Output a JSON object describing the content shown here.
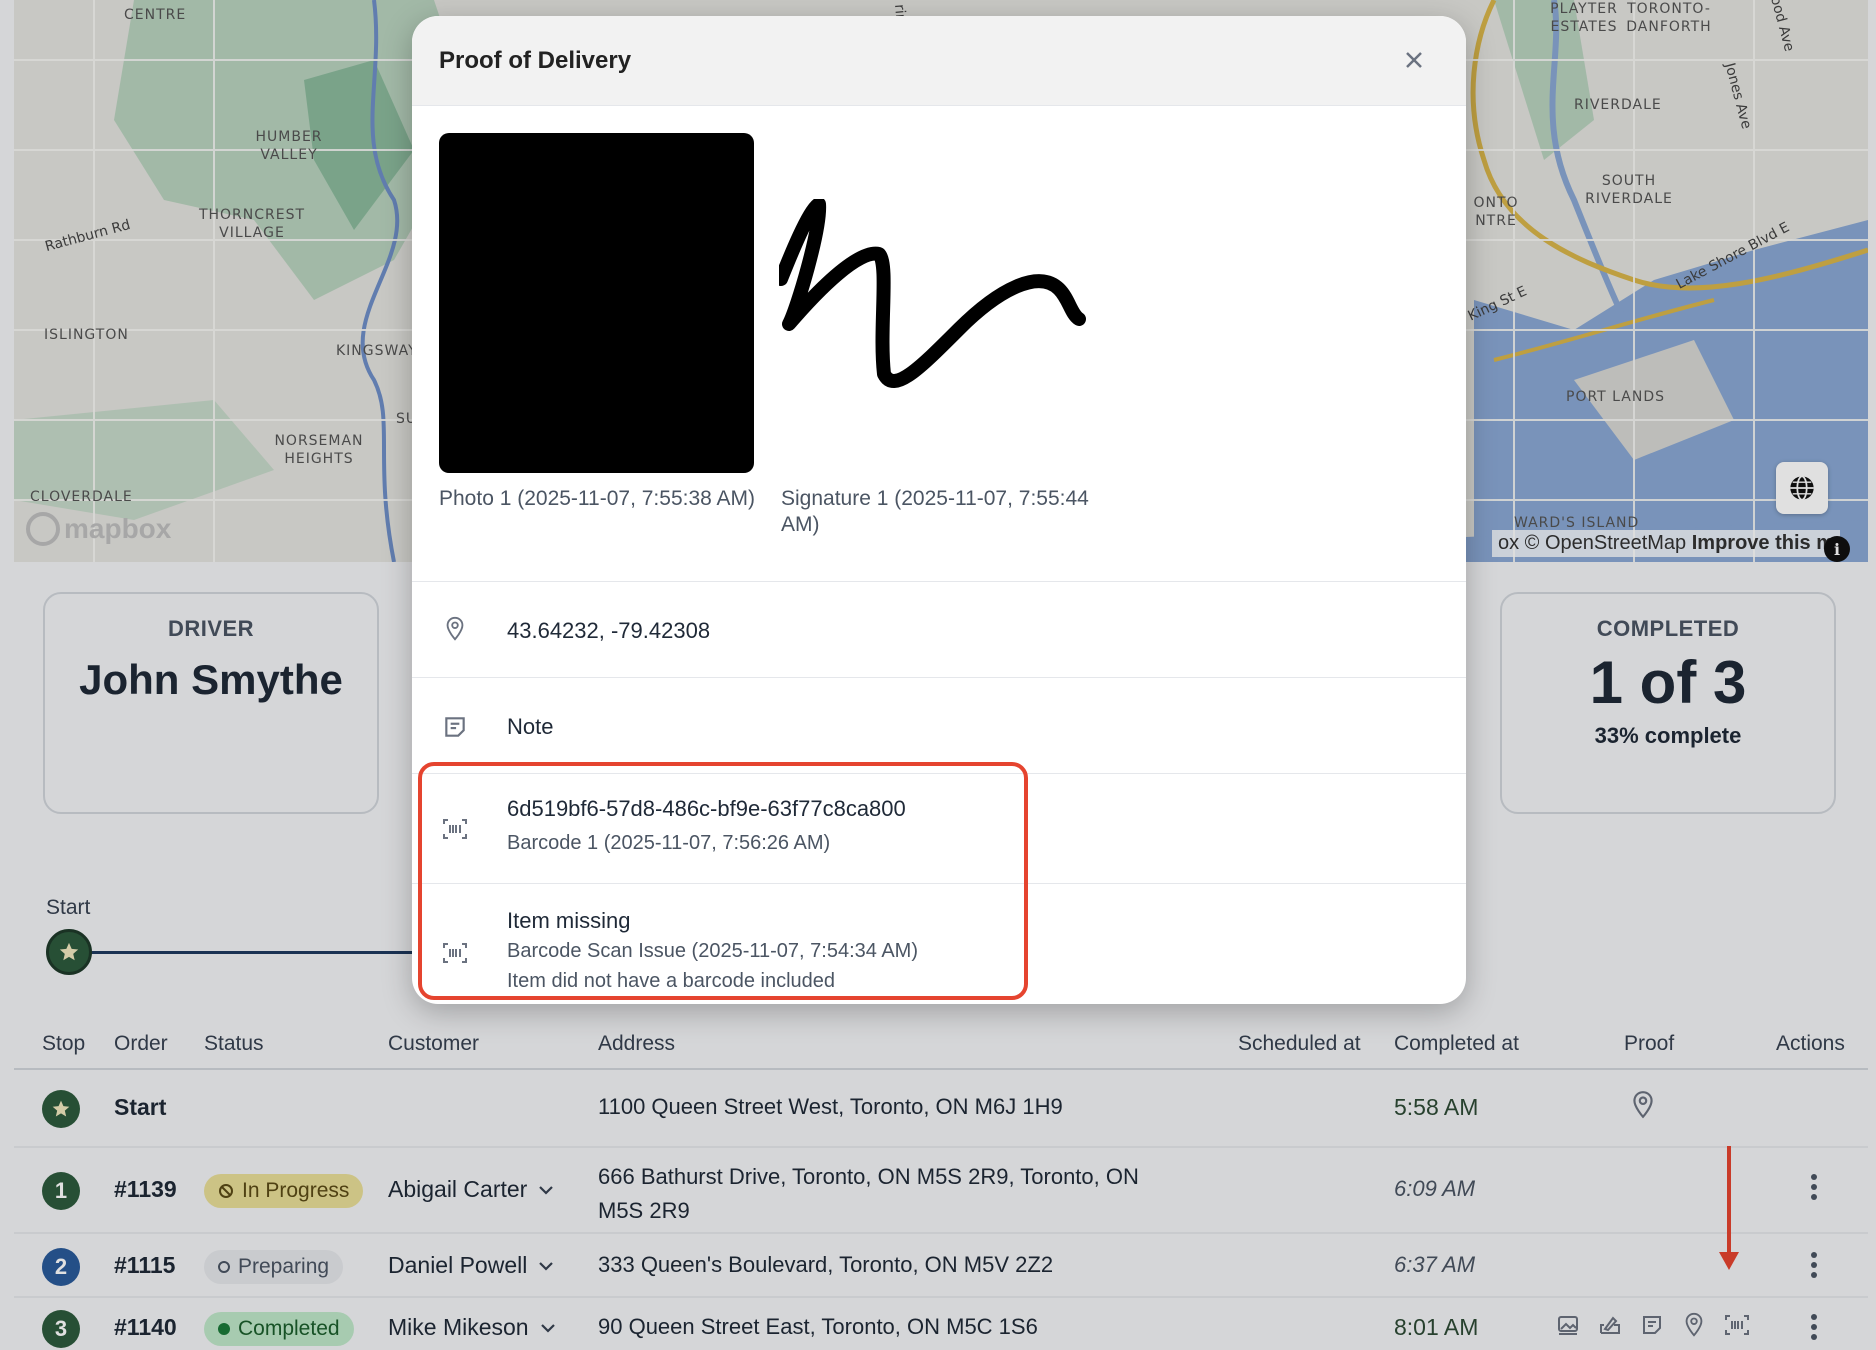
{
  "map": {
    "labels": [
      "CENTRE",
      "HUMBER VALLEY",
      "THORNCREST VILLAGE",
      "ISLINGTON",
      "KINGSWAY",
      "NORSEMAN HEIGHTS",
      "CLOVERDALE",
      "PLAYTER ESTATES",
      "TORONTO- DANFORTH",
      "RIVERDALE",
      "SOUTH RIVERDALE",
      "ONTO NTRE",
      "PORT LANDS",
      "WARD'S ISLAND",
      "SU"
    ],
    "roads": [
      "Rathburn Rd",
      "Jones Ave",
      "Lake Shore Blvd E",
      "King St E",
      "ood Ave",
      "rir"
    ],
    "logo": "mapbox",
    "attribution_prefix": "ox © OpenStreetMap",
    "attribution_link": "Improve this m",
    "info_icon": "i"
  },
  "cards": {
    "driver": {
      "label": "DRIVER",
      "value": "John Smythe"
    },
    "completed": {
      "label": "COMPLETED",
      "value": "1 of 3",
      "sub": "33% complete"
    }
  },
  "timeline": {
    "start_label": "Start"
  },
  "table": {
    "headers": {
      "stop": "Stop",
      "order": "Order",
      "status": "Status",
      "customer": "Customer",
      "address": "Address",
      "scheduled": "Scheduled at",
      "completed": "Completed at",
      "proof": "Proof",
      "actions": "Actions"
    },
    "rows": [
      {
        "order": "Start",
        "status": "",
        "customer": "",
        "address": "1100 Queen Street West, Toronto, ON M6J 1H9",
        "completed": "5:58 AM"
      },
      {
        "stop": "1",
        "order": "#1139",
        "status": "In Progress",
        "customer": "Abigail Carter",
        "address_line1": "666 Bathurst Drive, Toronto, ON M5S 2R9, Toronto, ON",
        "address_line2": "M5S 2R9",
        "completed": "6:09 AM"
      },
      {
        "stop": "2",
        "order": "#1115",
        "status": "Preparing",
        "customer": "Daniel Powell",
        "address": "333 Queen's Boulevard, Toronto, ON M5V 2Z2",
        "completed": "6:37 AM"
      },
      {
        "stop": "3",
        "order": "#1140",
        "status": "Completed",
        "customer": "Mike Mikeson",
        "address": "90 Queen Street East, Toronto, ON M5C 1S6",
        "completed": "8:01 AM"
      }
    ]
  },
  "modal": {
    "title": "Proof of Delivery",
    "photo_caption": "Photo 1 (2025-11-07, 7:55:38 AM)",
    "signature_caption": "Signature 1 (2025-11-07, 7:55:44 AM)",
    "location": "43.64232, -79.42308",
    "note": "Note",
    "barcode_value": "6d519bf6-57d8-486c-bf9e-63f77c8ca800",
    "barcode_caption": "Barcode 1 (2025-11-07, 7:56:26 AM)",
    "issue_title": "Item missing",
    "issue_caption": "Barcode Scan Issue (2025-11-07, 7:54:34 AM)",
    "issue_detail": "Item did not have a barcode included"
  },
  "colors": {
    "stop_green": "#2d5a3d",
    "stop_blue": "#2a5a9a",
    "highlight": "#e5442f",
    "water": "#8aa8d4",
    "park": "#9cc7a8"
  }
}
